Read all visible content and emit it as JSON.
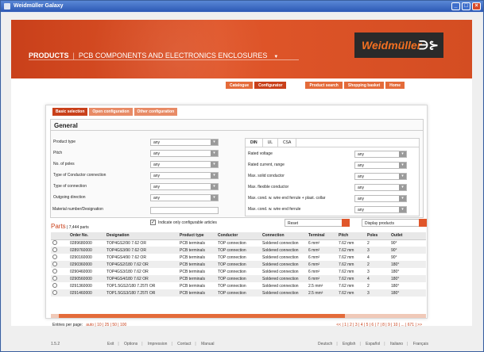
{
  "window": {
    "title": "Weidmüller Galaxy",
    "buttons": [
      "_",
      "□",
      "×"
    ]
  },
  "brand": {
    "logo_text": "Weidmüller",
    "logo_mark": "∋⊱"
  },
  "header": {
    "products": "PRODUCTS",
    "section": "PCB COMPONENTS AND ELECTRONICS ENCLOSURES",
    "arrow": "▼"
  },
  "nav": {
    "catalogue": "Catalogue",
    "configurator": "Configurator",
    "product_search": "Product search",
    "shopping_basket": "Shopping basket",
    "home": "Home"
  },
  "tabs": {
    "basic": "Basic selection",
    "open": "Open configuration",
    "other": "Other configuration"
  },
  "general": {
    "title": "General",
    "left_fields": [
      {
        "label": "Product type",
        "value": "any"
      },
      {
        "label": "Pitch",
        "value": "any"
      },
      {
        "label": "No. of poles",
        "value": "any"
      },
      {
        "label": "Type of Conductor connection",
        "value": "any"
      },
      {
        "label": "Type of connection",
        "value": "any"
      },
      {
        "label": "Outgoing direction",
        "value": "any"
      }
    ],
    "material_label": "Material number/Designation",
    "material_value": "",
    "right_tabs": [
      "DIN",
      "UL",
      "CSA"
    ],
    "right_fields": [
      {
        "label": "Rated voltage",
        "value": "any"
      },
      {
        "label": "Rated current, range",
        "value": "any"
      },
      {
        "label": "Max. solid conductor",
        "value": "any"
      },
      {
        "label": "Max. flexible conductor",
        "value": "any"
      },
      {
        "label": "Max. cond. w. wire end ferrule + plast. collar",
        "value": "any"
      },
      {
        "label": "Max. cond. w. wire end ferrule",
        "value": "any"
      }
    ]
  },
  "options": {
    "configurable_only": "Indicate only configurable articles",
    "checked": true,
    "reset": "Reset",
    "display": "Display products"
  },
  "parts": {
    "label": "Parts",
    "count": "7,444 parts"
  },
  "table": {
    "headers": [
      "",
      "Order No.",
      "Designation",
      "Product type",
      "Conductor",
      "Connection",
      "Terminal",
      "Pitch",
      "Poles",
      "Outlet"
    ],
    "rows": [
      [
        "0289680000",
        "TOP4GS2/90 7.62 OR",
        "PCB terminals",
        "TOP connection",
        "Soldered connection",
        "6 mm²",
        "7.62 mm",
        "2",
        "90°"
      ],
      [
        "0289760000",
        "TOP4GS3/90 7.62 OR",
        "PCB terminals",
        "TOP connection",
        "Soldered connection",
        "6 mm²",
        "7.62 mm",
        "3",
        "90°"
      ],
      [
        "0290160000",
        "TOP4GS4/90 7.62 OR",
        "PCB terminals",
        "TOP connection",
        "Soldered connection",
        "6 mm²",
        "7.62 mm",
        "4",
        "90°"
      ],
      [
        "0290360000",
        "TOP4GS2/180 7.62 OR",
        "PCB terminals",
        "TOP connection",
        "Soldered connection",
        "6 mm²",
        "7.62 mm",
        "2",
        "180°"
      ],
      [
        "0290460000",
        "TOP4GS3/180 7.62 OR",
        "PCB terminals",
        "TOP connection",
        "Soldered connection",
        "6 mm²",
        "7.62 mm",
        "3",
        "180°"
      ],
      [
        "0290560000",
        "TOP4GS4/180 7.62 OR",
        "PCB terminals",
        "TOP connection",
        "Soldered connection",
        "6 mm²",
        "7.62 mm",
        "4",
        "180°"
      ],
      [
        "0291360000",
        "TOP1.5GS2/180 7.25TI OR",
        "PCB terminals",
        "TOP connection",
        "Soldered connection",
        "2.5 mm²",
        "7.62 mm",
        "2",
        "180°"
      ],
      [
        "0291460000",
        "TOP1.5GS3/180 7.25TI OR",
        "PCB terminals",
        "TOP connection",
        "Soldered connection",
        "2.5 mm²",
        "7.62 mm",
        "3",
        "180°"
      ]
    ]
  },
  "paging": {
    "entries_label": "Entries per page:",
    "entries_options": "auto | 10 | 25 | 50 | 100",
    "pager": "<< | 1 | 2 | 3 | 4 | 5 | 6 | 7 | 8 | 9 | 10 | ... | 671 | >>"
  },
  "footer": {
    "version": "1.5.2",
    "links": [
      "Exit",
      "Options",
      "Impression",
      "Contact",
      "Manual"
    ],
    "languages": [
      "Deutsch",
      "English",
      "Español",
      "Italiano",
      "Français"
    ]
  },
  "colors": {
    "accent": "#c9401a",
    "accent_light": "#e46b3a",
    "logo_bg": "#2a2a2a",
    "logo_text": "#f37021"
  }
}
